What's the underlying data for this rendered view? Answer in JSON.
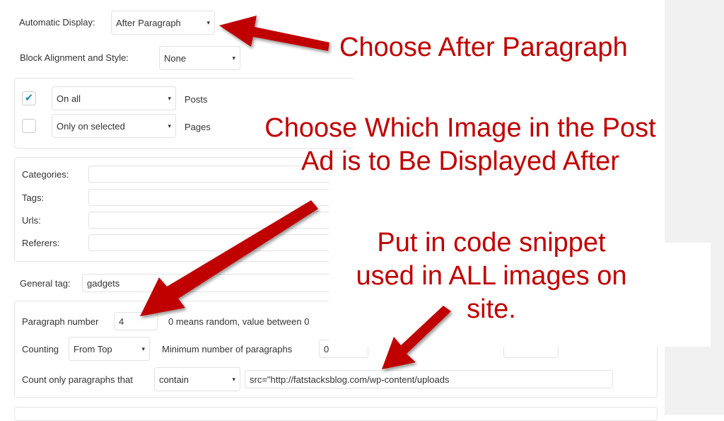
{
  "automatic_display": {
    "label": "Automatic Display:",
    "value": "After Paragraph"
  },
  "block_alignment": {
    "label": "Block Alignment and Style:",
    "value": "None"
  },
  "posts": {
    "checked": true,
    "select": "On all",
    "label": "Posts"
  },
  "pages": {
    "checked": false,
    "select": "Only on selected",
    "label": "Pages"
  },
  "filters": [
    {
      "label": "Categories:",
      "value": ""
    },
    {
      "label": "Tags:",
      "value": ""
    },
    {
      "label": "Urls:",
      "value": ""
    },
    {
      "label": "Referers:",
      "value": ""
    }
  ],
  "general_tag": {
    "label": "General tag:",
    "value": "gadgets"
  },
  "paragraph_number": {
    "label": "Paragraph number",
    "value": "4",
    "hint": "0 means random, value between 0"
  },
  "counting": {
    "label": "Counting",
    "value": "From Top",
    "min_label": "Minimum number of paragraphs",
    "min_value": "0"
  },
  "count_only": {
    "label": "Count only paragraphs that",
    "select": "contain",
    "value": "src=\"http://fatstacksblog.com/wp-content/uploads"
  },
  "annotations": {
    "a1": "Choose After Paragraph",
    "a2_line1": "Choose Which Image in the Post",
    "a2_line2": "Ad is to Be Displayed After",
    "a3_line1": "Put in code snippet",
    "a3_line2": "used in ALL images on",
    "a3_line3": "site."
  },
  "colors": {
    "annotation": "#c00000",
    "checkbox": "#1e8cbe",
    "side_panel": "#f1f1f1"
  }
}
